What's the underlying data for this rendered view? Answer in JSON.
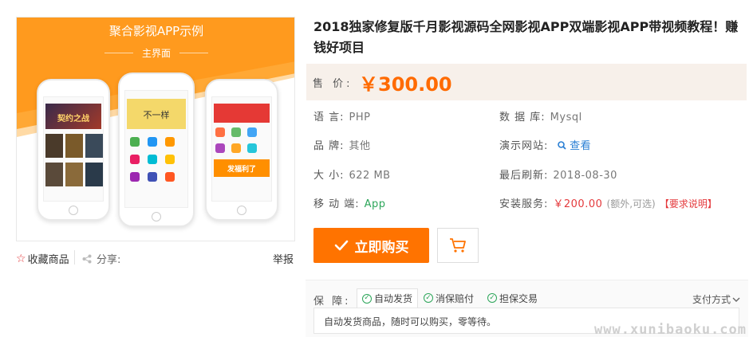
{
  "image": {
    "title": "聚合影视APP示例",
    "subtitle": "主界面",
    "phone1_banner": "契约之战",
    "phone2_banner": "不一样",
    "phone3_banner": "发福利了"
  },
  "image_actions": {
    "favorite": "收藏商品",
    "share": "分享:",
    "report": "举报"
  },
  "product": {
    "title": "2018独家修复版千月影视源码全网影视APP双端影视APP带视频教程！赚钱好项目",
    "price_label": "售 价:",
    "price": "￥300.00"
  },
  "specs": {
    "language_label": "语 言:",
    "language": "PHP",
    "database_label": "数 据 库:",
    "database": "Mysql",
    "brand_label": "品 牌:",
    "brand": "其他",
    "demo_label": "演示网站:",
    "demo_link": "查看",
    "size_label": "大 小:",
    "size": "622 MB",
    "updated_label": "最后刷新:",
    "updated": "2018-08-30",
    "mobile_label": "移 动 端:",
    "mobile": "App",
    "install_label": "安装服务:",
    "install_price": "￥200.00",
    "install_note": "(额外,可选)",
    "install_req": "【要求说明】"
  },
  "actions": {
    "buy": "立即购买"
  },
  "guarantee": {
    "label": "保 障:",
    "tabs": [
      "自动发货",
      "消保赔付",
      "担保交易"
    ],
    "pay_method": "支付方式",
    "content": "自动发货商品，随时可以购买，零等待。"
  },
  "watermark": "www.xunibaoku.com",
  "colors": {
    "accent": "#ff7300",
    "price": "#ff6a00",
    "green": "#2da65a",
    "red": "#e4393c"
  }
}
